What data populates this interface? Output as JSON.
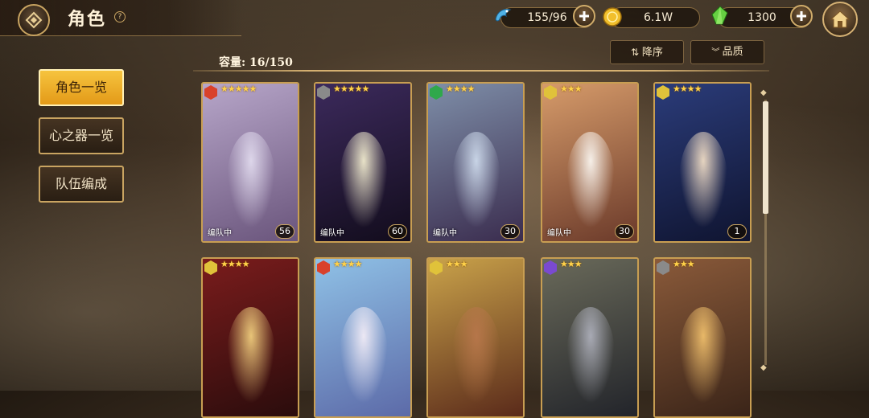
{
  "header": {
    "title": "角色",
    "help_label": "?"
  },
  "resources": [
    {
      "name": "stamina",
      "value": "155/96",
      "icon": "blue-dragon-icon",
      "color": "#5fb8e8"
    },
    {
      "name": "gold",
      "value": "6.1W",
      "icon": "gold-coin-icon",
      "color": "#f3c230"
    },
    {
      "name": "gems",
      "value": "1300",
      "icon": "green-crystal-icon",
      "color": "#6fd14a"
    }
  ],
  "side_menu": {
    "items": [
      {
        "label": "角色一览",
        "active": true
      },
      {
        "label": "心之器一览",
        "active": false
      },
      {
        "label": "队伍编成",
        "active": false
      }
    ]
  },
  "content": {
    "capacity": "容量: 16/150",
    "sort_label": "降序",
    "filter_label": "品质"
  },
  "cards": [
    {
      "stars": "★★★★★",
      "status": "编队中",
      "level": "56",
      "attr_color": "#d9412b",
      "colors": [
        "#b7a6c9",
        "#6a557c"
      ],
      "figure": "#ddd6ea"
    },
    {
      "stars": "★★★★★",
      "status": "编队中",
      "level": "60",
      "attr_color": "#8a8a8a",
      "colors": [
        "#3c2a5c",
        "#120c1c"
      ],
      "figure": "#e8e2c8"
    },
    {
      "stars": "★★★★",
      "status": "编队中",
      "level": "30",
      "attr_color": "#2fa84c",
      "colors": [
        "#7e8ea8",
        "#3a2c4e"
      ],
      "figure": "#c8d4e6"
    },
    {
      "stars": "★★★",
      "status": "编队中",
      "level": "30",
      "attr_color": "#e0c23a",
      "colors": [
        "#d69b6a",
        "#6b3a2a"
      ],
      "figure": "#f6efe8"
    },
    {
      "stars": "★★★★",
      "status": "",
      "level": "1",
      "attr_color": "#e0c23a",
      "colors": [
        "#2b3c7a",
        "#0f1430"
      ],
      "figure": "#e6d4c0"
    },
    {
      "stars": "★★★★",
      "status": "",
      "level": "",
      "attr_color": "#e0c23a",
      "colors": [
        "#7a1c1c",
        "#2a0c0c"
      ],
      "figure": "#e8c478"
    },
    {
      "stars": "★★★★",
      "status": "",
      "level": "",
      "attr_color": "#d9412b",
      "colors": [
        "#8fc1e6",
        "#5c6aa8"
      ],
      "figure": "#ece8f4"
    },
    {
      "stars": "★★★",
      "status": "",
      "level": "",
      "attr_color": "#e0c23a",
      "colors": [
        "#c9a24a",
        "#5a2a1a"
      ],
      "figure": "#b6764a"
    },
    {
      "stars": "★★★",
      "status": "",
      "level": "",
      "attr_color": "#7a4ad0",
      "colors": [
        "#6a6a5a",
        "#22242a"
      ],
      "figure": "#a8aab4"
    },
    {
      "stars": "★★★",
      "status": "",
      "level": "",
      "attr_color": "#8a8a8a",
      "colors": [
        "#8a5a3a",
        "#3a2418"
      ],
      "figure": "#e8b868"
    }
  ]
}
